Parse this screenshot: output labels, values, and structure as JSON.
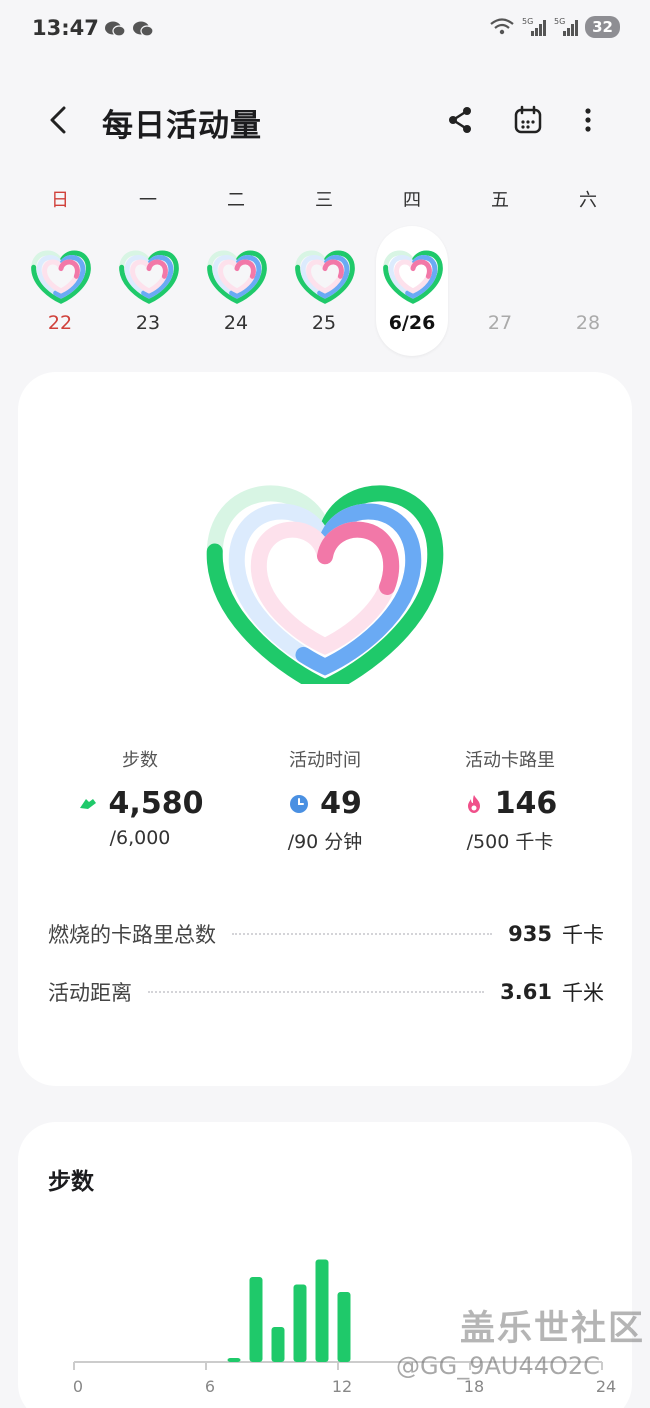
{
  "status_bar": {
    "time": "13:47",
    "signal_labels": [
      "5G",
      "5G"
    ],
    "battery": "32"
  },
  "header": {
    "title": "每日活动量"
  },
  "week": [
    {
      "weekday": "日",
      "date": "22",
      "state": "past",
      "is_sunday": true
    },
    {
      "weekday": "一",
      "date": "23",
      "state": "past"
    },
    {
      "weekday": "二",
      "date": "24",
      "state": "past"
    },
    {
      "weekday": "三",
      "date": "25",
      "state": "past"
    },
    {
      "weekday": "四",
      "date": "6/26",
      "state": "selected"
    },
    {
      "weekday": "五",
      "date": "27",
      "state": "future"
    },
    {
      "weekday": "六",
      "date": "28",
      "state": "future"
    }
  ],
  "activity": {
    "rings": [
      {
        "name": "steps",
        "color": "#1fc96a",
        "progress": 0.763
      },
      {
        "name": "active_time",
        "color": "#6aaaf4",
        "progress": 0.544
      },
      {
        "name": "active_calories",
        "color": "#f278a8",
        "progress": 0.292
      }
    ],
    "stats": [
      {
        "label": "步数",
        "value": "4,580",
        "goal": "/6,000",
        "icon": "shoe-icon",
        "color": "#1fc96a"
      },
      {
        "label": "活动时间",
        "value": "49",
        "goal": "/90 分钟",
        "icon": "clock-icon",
        "color": "#4a90e2"
      },
      {
        "label": "活动卡路里",
        "value": "146",
        "goal": "/500 千卡",
        "icon": "flame-icon",
        "color": "#f0508a"
      }
    ],
    "details": [
      {
        "label": "燃烧的卡路里总数",
        "value": "935",
        "unit": "千卡"
      },
      {
        "label": "活动距离",
        "value": "3.61",
        "unit": "千米"
      }
    ]
  },
  "steps_card": {
    "title": "步数"
  },
  "chart_data": {
    "type": "bar",
    "x_ticks": [
      "0",
      "6",
      "12",
      "18",
      "24"
    ],
    "x": [
      7,
      8,
      9,
      10,
      11,
      12
    ],
    "values": [
      80,
      1700,
      700,
      1550,
      2050,
      1400
    ],
    "xlim": [
      0,
      24
    ],
    "ylim": [
      0,
      2200
    ],
    "color": "#1fc96a"
  },
  "watermark": {
    "text": "盖乐世社区",
    "handle": "@GG_9AU44O2C"
  }
}
